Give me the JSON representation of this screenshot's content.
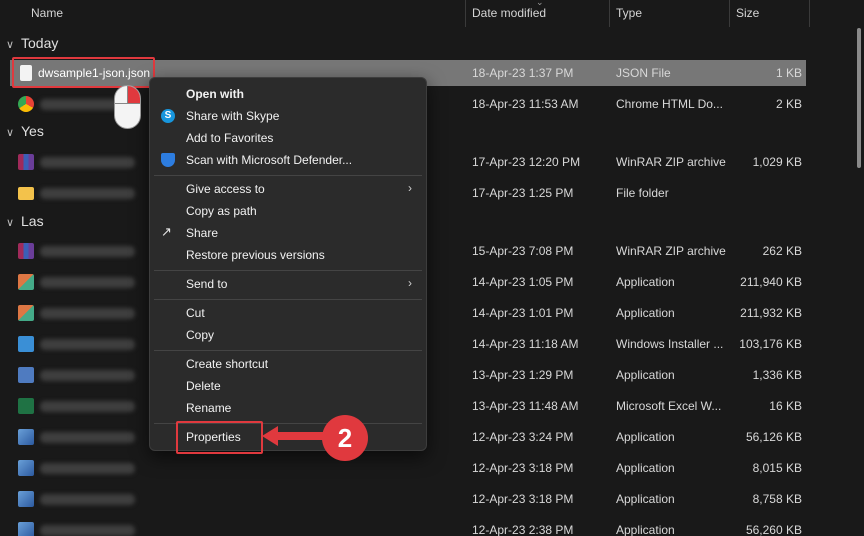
{
  "header": {
    "name": "Name",
    "date_modified": "Date modified",
    "type": "Type",
    "size": "Size"
  },
  "groups": {
    "today": "Today",
    "yesterday_partial": "Yes",
    "last_partial": "Las"
  },
  "rows": [
    {
      "name": "dwsample1-json.json",
      "date": "18-Apr-23 1:37 PM",
      "type": "JSON File",
      "size": "1 KB",
      "icon": "json-file-icon"
    },
    {
      "name": "",
      "date": "18-Apr-23 11:53 AM",
      "type": "Chrome HTML Do...",
      "size": "2 KB",
      "icon": "chrome-icon"
    },
    {
      "name": "",
      "date": "17-Apr-23 12:20 PM",
      "type": "WinRAR ZIP archive",
      "size": "1,029 KB",
      "icon": "winrar-icon"
    },
    {
      "name": "",
      "date": "17-Apr-23 1:25 PM",
      "type": "File folder",
      "size": "",
      "icon": "folder-icon"
    },
    {
      "name": "",
      "date": "15-Apr-23 7:08 PM",
      "type": "WinRAR ZIP archive",
      "size": "262 KB",
      "icon": "winrar-icon"
    },
    {
      "name": "",
      "date": "14-Apr-23 1:05 PM",
      "type": "Application",
      "size": "211,940 KB",
      "icon": "application-icon"
    },
    {
      "name": "",
      "date": "14-Apr-23 1:01 PM",
      "type": "Application",
      "size": "211,932 KB",
      "icon": "application-icon"
    },
    {
      "name": "",
      "date": "14-Apr-23 11:18 AM",
      "type": "Windows Installer ...",
      "size": "103,176 KB",
      "icon": "installer-icon"
    },
    {
      "name": "",
      "date": "13-Apr-23 1:29 PM",
      "type": "Application",
      "size": "1,336 KB",
      "icon": "setup-icon"
    },
    {
      "name": "",
      "date": "13-Apr-23 11:48 AM",
      "type": "Microsoft Excel W...",
      "size": "16 KB",
      "icon": "excel-icon"
    },
    {
      "name": "",
      "date": "12-Apr-23 3:24 PM",
      "type": "Application",
      "size": "56,126 KB",
      "icon": "setup-icon"
    },
    {
      "name": "",
      "date": "12-Apr-23 3:18 PM",
      "type": "Application",
      "size": "8,015 KB",
      "icon": "setup-icon"
    },
    {
      "name": "",
      "date": "12-Apr-23 3:18 PM",
      "type": "Application",
      "size": "8,758 KB",
      "icon": "setup-icon"
    },
    {
      "name": "",
      "date": "12-Apr-23 2:38 PM",
      "type": "Application",
      "size": "56,260 KB",
      "icon": "setup-icon"
    }
  ],
  "context_menu": {
    "open_with": "Open with",
    "share_skype": "Share with Skype",
    "add_favorites": "Add to Favorites",
    "scan_defender": "Scan with Microsoft Defender...",
    "give_access": "Give access to",
    "copy_path": "Copy as path",
    "share": "Share",
    "restore_versions": "Restore previous versions",
    "send_to": "Send to",
    "cut": "Cut",
    "copy": "Copy",
    "create_shortcut": "Create shortcut",
    "delete": "Delete",
    "rename": "Rename",
    "properties": "Properties"
  },
  "annotation": {
    "step_number": "2",
    "highlight_color": "#e0393e"
  }
}
